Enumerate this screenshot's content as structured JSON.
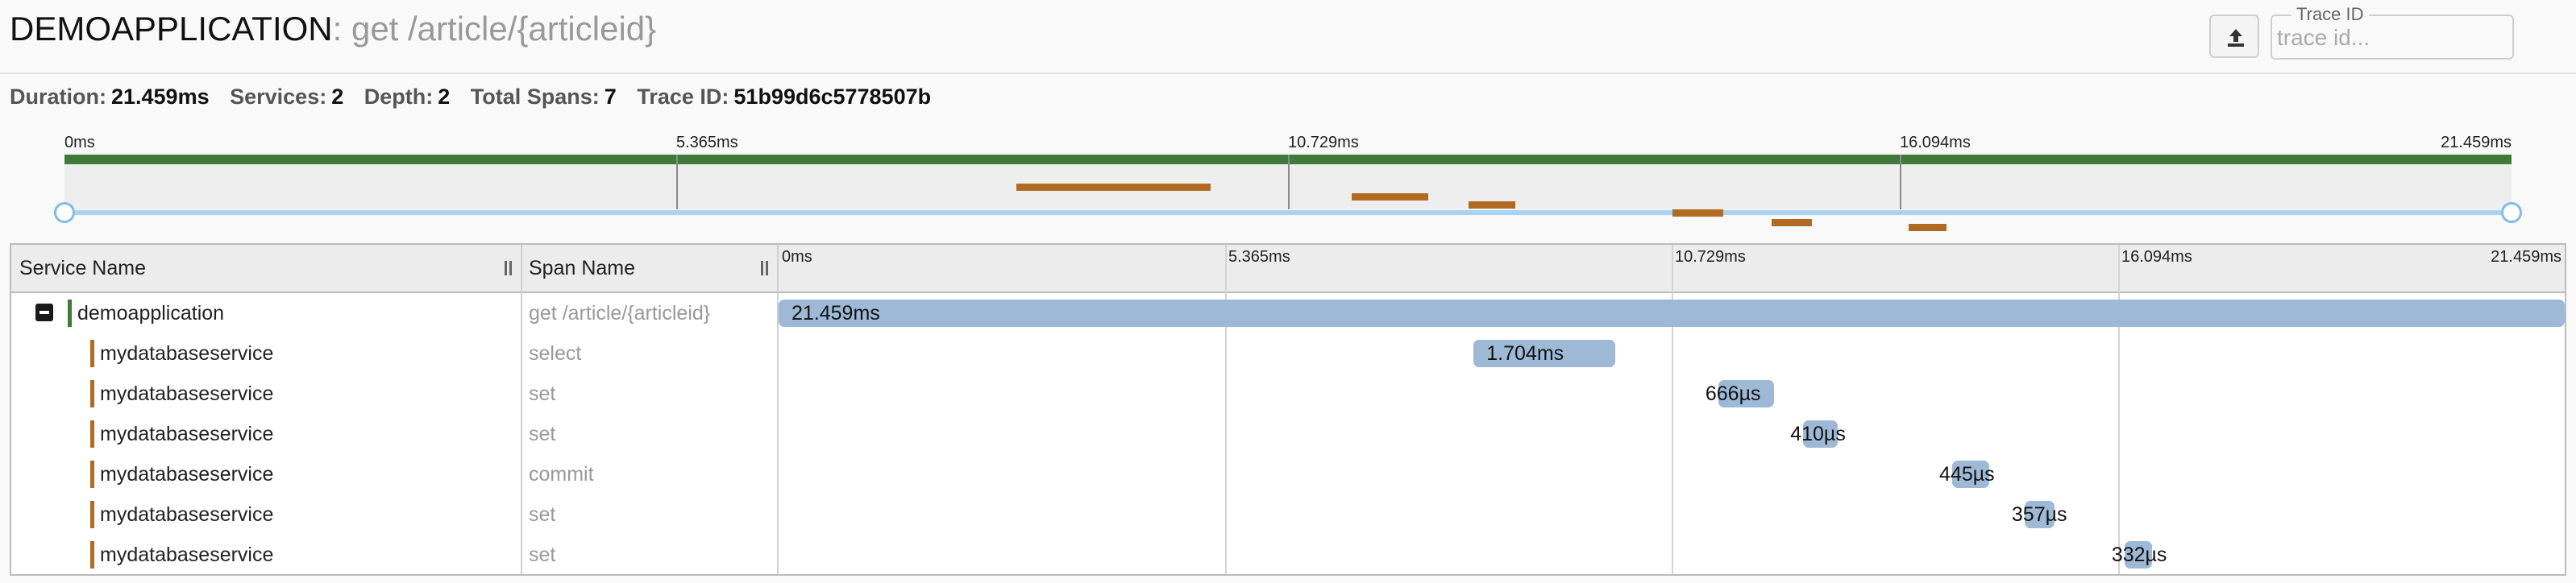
{
  "header": {
    "service": "DEMOAPPLICATION",
    "operation": ": get /article/{articleid}",
    "trace_id_legend": "Trace ID",
    "trace_id_placeholder": "trace id..."
  },
  "summary": {
    "duration_label": "Duration:",
    "duration": "21.459ms",
    "services_label": "Services:",
    "services": "2",
    "depth_label": "Depth:",
    "depth": "2",
    "spans_label": "Total Spans:",
    "spans": "7",
    "trace_label": "Trace ID:",
    "trace_id": "51b99d6c5778507b"
  },
  "ticks": [
    "0ms",
    "5.365ms",
    "10.729ms",
    "16.094ms",
    "21.459ms"
  ],
  "table": {
    "service_header": "Service Name",
    "span_header": "Span Name"
  },
  "colors": {
    "root_service": "#3f7a3a",
    "child_service": "#b06a22",
    "span_bar": "#9db9d6"
  },
  "total_ms": 21.459,
  "spans": [
    {
      "service": "demoapplication",
      "name": "get /article/{articleid}",
      "start_ms": 0,
      "duration_ms": 21.459,
      "label": "21.459ms",
      "depth": 0
    },
    {
      "service": "mydatabaseservice",
      "name": "select",
      "start_ms": 8.35,
      "duration_ms": 1.704,
      "label": "1.704ms",
      "depth": 1
    },
    {
      "service": "mydatabaseservice",
      "name": "set",
      "start_ms": 11.29,
      "duration_ms": 0.666,
      "label": "666µs",
      "depth": 1
    },
    {
      "service": "mydatabaseservice",
      "name": "set",
      "start_ms": 12.31,
      "duration_ms": 0.41,
      "label": "410µs",
      "depth": 1
    },
    {
      "service": "mydatabaseservice",
      "name": "commit",
      "start_ms": 14.1,
      "duration_ms": 0.445,
      "label": "445µs",
      "depth": 1
    },
    {
      "service": "mydatabaseservice",
      "name": "set",
      "start_ms": 14.97,
      "duration_ms": 0.357,
      "label": "357µs",
      "depth": 1
    },
    {
      "service": "mydatabaseservice",
      "name": "set",
      "start_ms": 16.17,
      "duration_ms": 0.332,
      "label": "332µs",
      "depth": 1
    }
  ]
}
